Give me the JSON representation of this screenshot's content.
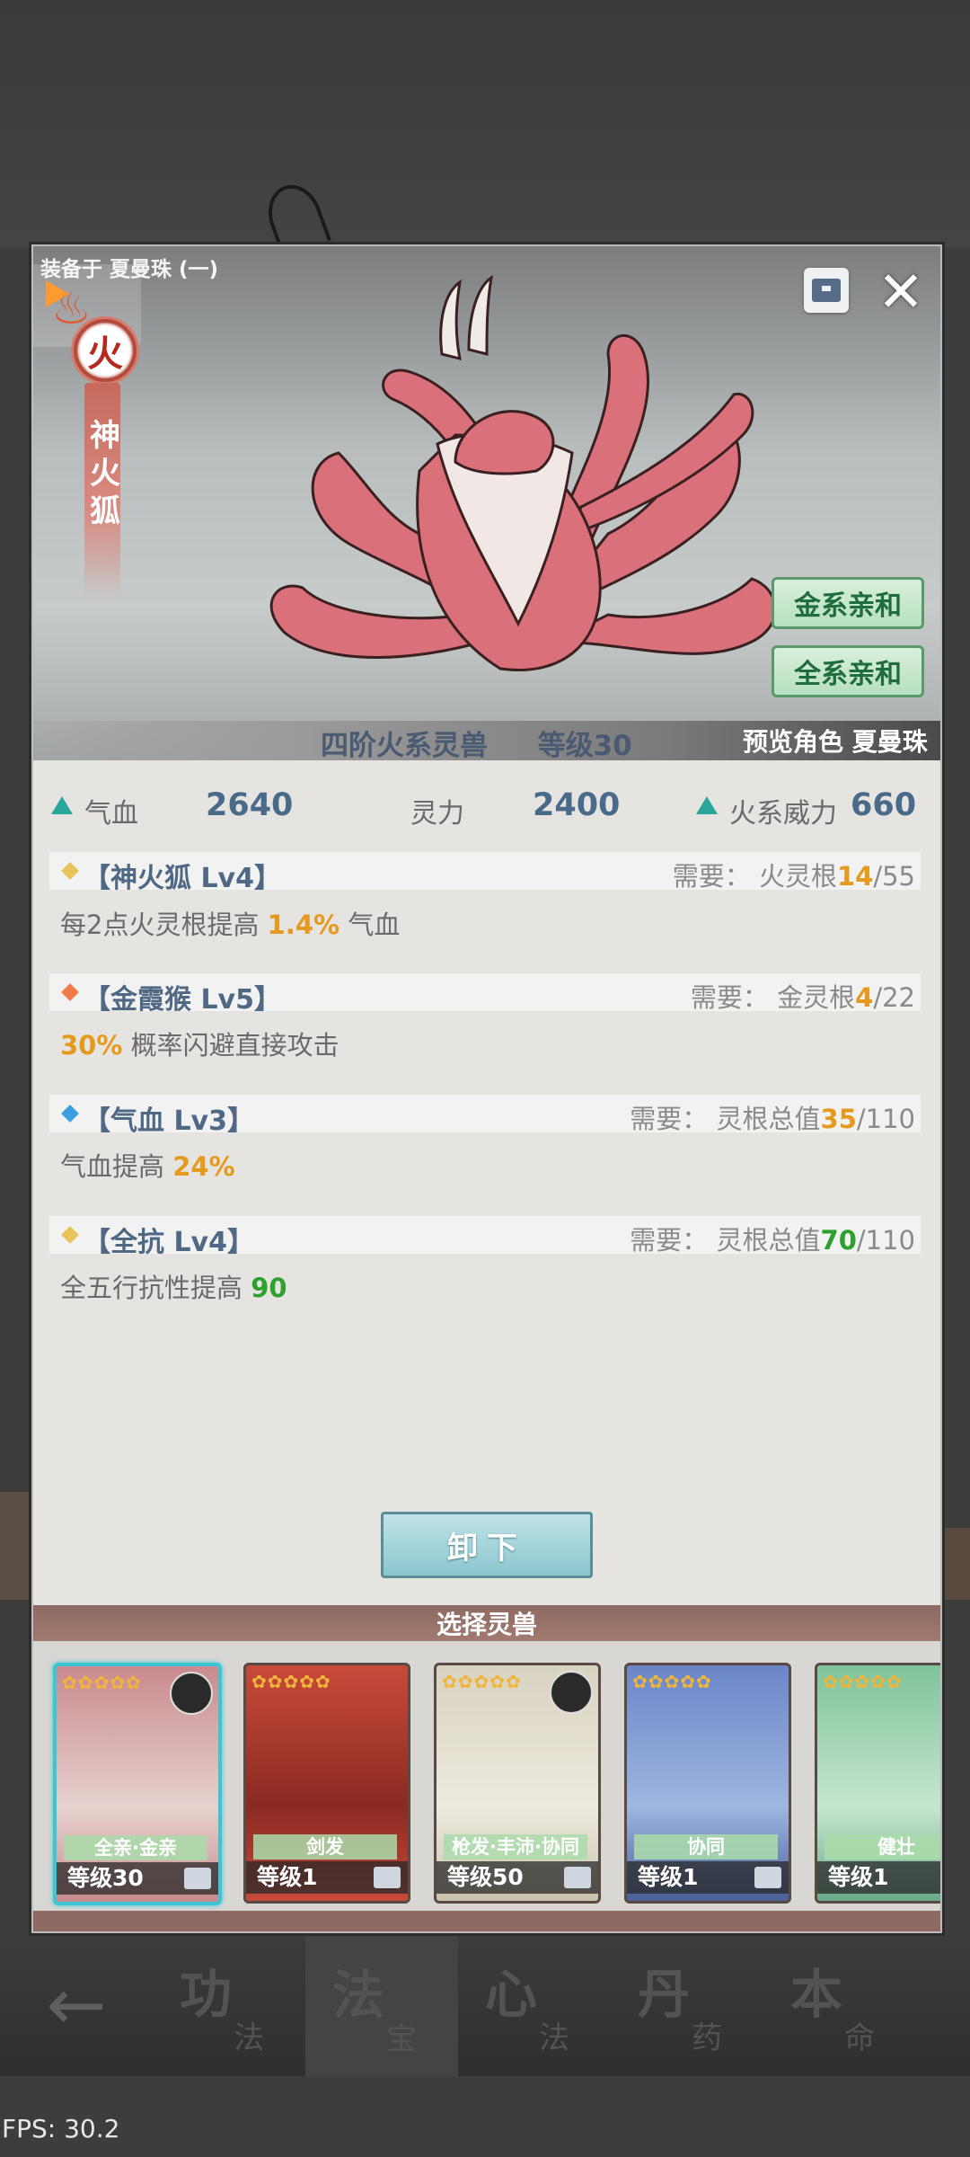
{
  "fps": "FPS: 30.2",
  "equip": {
    "label": "装备于 夏曼珠 (一)"
  },
  "beast": {
    "element": "火",
    "name_chars": [
      "神",
      "火",
      "狐"
    ],
    "tags": [
      "金系亲和",
      "全系亲和"
    ],
    "tier": "四阶火系灵兽",
    "level": "等级30",
    "preview": "预览角色 夏曼珠"
  },
  "stats": [
    {
      "label": "气血",
      "value": "2640"
    },
    {
      "label": "灵力",
      "value": "2400"
    },
    {
      "label": "火系威力",
      "value": "660"
    }
  ],
  "skills": [
    {
      "name": "【神火狐 Lv4】",
      "req_label": "需要：",
      "req_type": "火灵根",
      "req_cur": "14",
      "req_max": "/55",
      "desc_pre": "每2点火灵根提高 ",
      "desc_val": "1.4%",
      "desc_post": " 气血"
    },
    {
      "name": "【金霞猴 Lv5】",
      "req_label": "需要：",
      "req_type": "金灵根",
      "req_cur": "4",
      "req_max": "/22",
      "desc_pre": "",
      "desc_val": "30%",
      "desc_post": " 概率闪避直接攻击"
    },
    {
      "name": "【气血 Lv3】",
      "req_label": "需要：",
      "req_type": "灵根总值",
      "req_cur": "35",
      "req_max": "/110",
      "desc_pre": "气血提高 ",
      "desc_val": "24%",
      "desc_post": ""
    },
    {
      "name": "【全抗 Lv4】",
      "req_label": "需要：",
      "req_type": "灵根总值",
      "req_cur": "70",
      "req_max": "/110",
      "desc_pre": "全五行抗性提高 ",
      "desc_val": "90",
      "desc_post": ""
    }
  ],
  "unequip_label": "卸下",
  "select_title": "选择灵兽",
  "cards": [
    {
      "tag": "全亲·金亲",
      "level": "等级30"
    },
    {
      "tag": "剑发",
      "level": "等级1"
    },
    {
      "tag": "枪发·丰沛·协同",
      "level": "等级50"
    },
    {
      "tag": "协同",
      "level": "等级1"
    },
    {
      "tag": "健壮",
      "level": "等级1"
    }
  ],
  "nav": {
    "items": [
      {
        "big": "功",
        "small": "法"
      },
      {
        "big": "法",
        "small": "宝"
      },
      {
        "big": "心",
        "small": "法"
      },
      {
        "big": "丹",
        "small": "药"
      },
      {
        "big": "本",
        "small": "命"
      }
    ]
  },
  "colors": {
    "highlight_orange": "#e59a1f",
    "highlight_green": "#2ea02e",
    "accent_teal": "#2aa79a",
    "diamond_gold": "#e8c35a",
    "diamond_orange": "#f07c4a",
    "diamond_blue": "#3a9ee0"
  }
}
